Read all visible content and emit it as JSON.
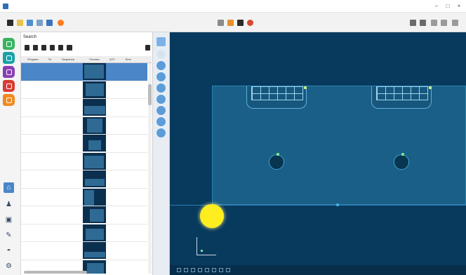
{
  "window": {
    "title": ""
  },
  "panel": {
    "title": "Search",
    "columns": [
      "Program",
      "Th",
      "Sequence",
      "Preview",
      "QTY",
      "Time"
    ],
    "rows": [
      {
        "program": "",
        "th": "",
        "sequence": "",
        "qty": "",
        "time": ""
      },
      {
        "program": "",
        "th": "",
        "sequence": "",
        "qty": "",
        "time": ""
      },
      {
        "program": "",
        "th": "",
        "sequence": "",
        "qty": "",
        "time": ""
      },
      {
        "program": "",
        "th": "",
        "sequence": "",
        "qty": "",
        "time": ""
      },
      {
        "program": "",
        "th": "",
        "sequence": "",
        "qty": "",
        "time": ""
      },
      {
        "program": "",
        "th": "",
        "sequence": "",
        "qty": "",
        "time": ""
      },
      {
        "program": "",
        "th": "",
        "sequence": "",
        "qty": "",
        "time": ""
      },
      {
        "program": "",
        "th": "",
        "sequence": "",
        "qty": "",
        "time": ""
      },
      {
        "program": "",
        "th": "",
        "sequence": "",
        "qty": "",
        "time": ""
      },
      {
        "program": "",
        "th": "",
        "sequence": "",
        "qty": "",
        "time": ""
      },
      {
        "program": "",
        "th": "",
        "sequence": "",
        "qty": "",
        "time": ""
      },
      {
        "program": "",
        "th": "",
        "sequence": "",
        "qty": "",
        "time": ""
      }
    ]
  },
  "icons": {
    "toolbar": [
      "save-icon",
      "folder-icon",
      "edit-icon",
      "print-icon",
      "settings-icon",
      "color-icon",
      "undo-icon",
      "redo-icon"
    ],
    "left_tabs": [
      "green-tab-icon",
      "teal-tab-icon",
      "purple-tab-icon",
      "red-tab-icon",
      "orange-tab-icon"
    ]
  },
  "colors": {
    "canvas": "#083a5e",
    "plate": "#1a5f87",
    "selection": "#4a86c8",
    "cursor": "#ffee1f"
  }
}
